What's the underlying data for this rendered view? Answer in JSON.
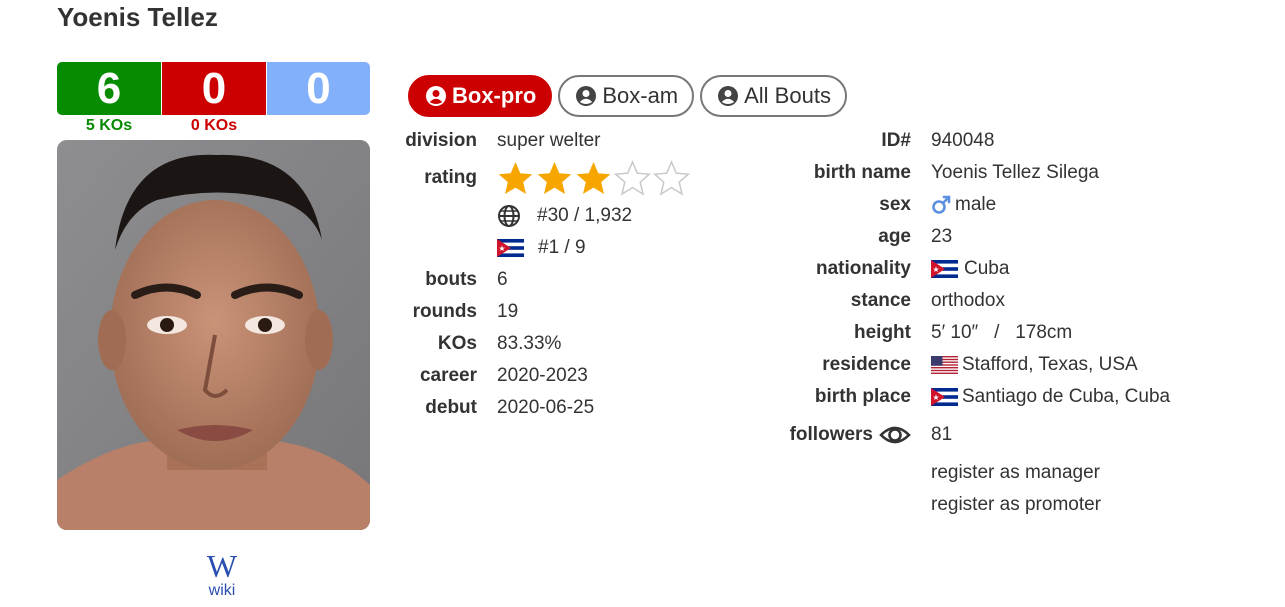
{
  "boxer": {
    "name": "Yoenis Tellez"
  },
  "record": {
    "wins": "6",
    "losses": "0",
    "draws": "0",
    "win_kos": "5 KOs",
    "loss_kos": "0 KOs"
  },
  "wiki": {
    "glyph": "W",
    "label": "wiki"
  },
  "tabs": [
    {
      "label": "Box-pro",
      "active": true
    },
    {
      "label": "Box-am",
      "active": false
    },
    {
      "label": "All Bouts",
      "active": false
    }
  ],
  "left": {
    "division_label": "division",
    "division": "super welter",
    "rating_label": "rating",
    "rating_stars": 3,
    "rating_max": 5,
    "world_rank": "#30 / 1,932",
    "country_rank": "#1 / 9",
    "bouts_label": "bouts",
    "bouts": "6",
    "rounds_label": "rounds",
    "rounds": "19",
    "kos_label": "KOs",
    "kos": "83.33%",
    "career_label": "career",
    "career": "2020-2023",
    "debut_label": "debut",
    "debut": "2020-06-25"
  },
  "right": {
    "id_label": "ID#",
    "id": "940048",
    "birth_name_label": "birth name",
    "birth_name": "Yoenis Tellez Silega",
    "sex_label": "sex",
    "sex": "male",
    "age_label": "age",
    "age": "23",
    "nationality_label": "nationality",
    "nationality": "Cuba",
    "stance_label": "stance",
    "stance": "orthodox",
    "height_label": "height",
    "height": "5′ 10″   /   178cm",
    "residence_label": "residence",
    "residence": "Stafford, Texas, USA",
    "birth_place_label": "birth place",
    "birth_place": "Santiago de Cuba, Cuba",
    "followers_label": "followers",
    "followers": "81",
    "register_manager": "register as manager",
    "register_promoter": "register as promoter"
  },
  "colors": {
    "win": "#078b00",
    "loss": "#cc0000",
    "draw": "#83b0fb",
    "star": "#f7a600",
    "link": "#a8161f"
  },
  "icons": [
    "user-circle-icon",
    "globe-icon",
    "cuba-flag-icon",
    "usa-flag-icon",
    "male-symbol-icon",
    "eye-icon",
    "star-icon",
    "wikipedia-icon"
  ]
}
